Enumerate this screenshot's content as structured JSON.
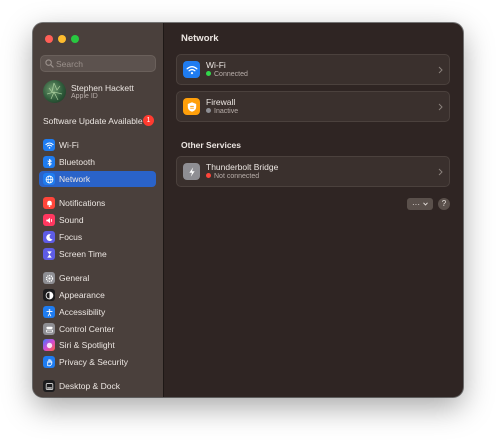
{
  "sidebar": {
    "search": {
      "placeholder": "Search"
    },
    "profile": {
      "name": "Stephen Hackett",
      "subtitle": "Apple ID"
    },
    "software_update": {
      "label": "Software Update Available",
      "badge": "1"
    },
    "items": [
      {
        "label": "Wi-Fi",
        "icon": "wifi-icon",
        "color": "#1f7cf0"
      },
      {
        "label": "Bluetooth",
        "icon": "bluetooth-icon",
        "color": "#1f7cf0"
      },
      {
        "label": "Network",
        "icon": "globe-icon",
        "color": "#1f7cf0",
        "active": true
      },
      {
        "label": "Notifications",
        "icon": "bell-icon",
        "color": "#ff453a"
      },
      {
        "label": "Sound",
        "icon": "speaker-icon",
        "color": "#ff375f"
      },
      {
        "label": "Focus",
        "icon": "moon-icon",
        "color": "#5e5ce6"
      },
      {
        "label": "Screen Time",
        "icon": "hourglass-icon",
        "color": "#5e5ce6"
      },
      {
        "label": "General",
        "icon": "gear-icon",
        "color": "#8e8e93"
      },
      {
        "label": "Appearance",
        "icon": "appearance-icon",
        "color": "#1c1c1e"
      },
      {
        "label": "Accessibility",
        "icon": "accessibility-icon",
        "color": "#1f7cf0"
      },
      {
        "label": "Control Center",
        "icon": "control-center-icon",
        "color": "#8e8e93"
      },
      {
        "label": "Siri & Spotlight",
        "icon": "siri-icon",
        "color": "#b04dd6"
      },
      {
        "label": "Privacy & Security",
        "icon": "hand-icon",
        "color": "#1f7cf0"
      },
      {
        "label": "Desktop & Dock",
        "icon": "dock-icon",
        "color": "#1c1c1e"
      }
    ]
  },
  "main": {
    "title": "Network",
    "services": [
      {
        "title": "Wi-Fi",
        "status": "Connected",
        "status_color": "#32d74b",
        "icon": "wifi-icon",
        "color": "#1f7cf0"
      },
      {
        "title": "Firewall",
        "status": "Inactive",
        "status_color": "#8e8e93",
        "icon": "firewall-icon",
        "color": "#ff9f0a"
      }
    ],
    "other_section_title": "Other Services",
    "other_services": [
      {
        "title": "Thunderbolt Bridge",
        "status": "Not connected",
        "status_color": "#ff453a",
        "icon": "thunderbolt-icon",
        "color": "#8e8e93"
      }
    ],
    "more_button_label": "···",
    "help_button_label": "?"
  }
}
